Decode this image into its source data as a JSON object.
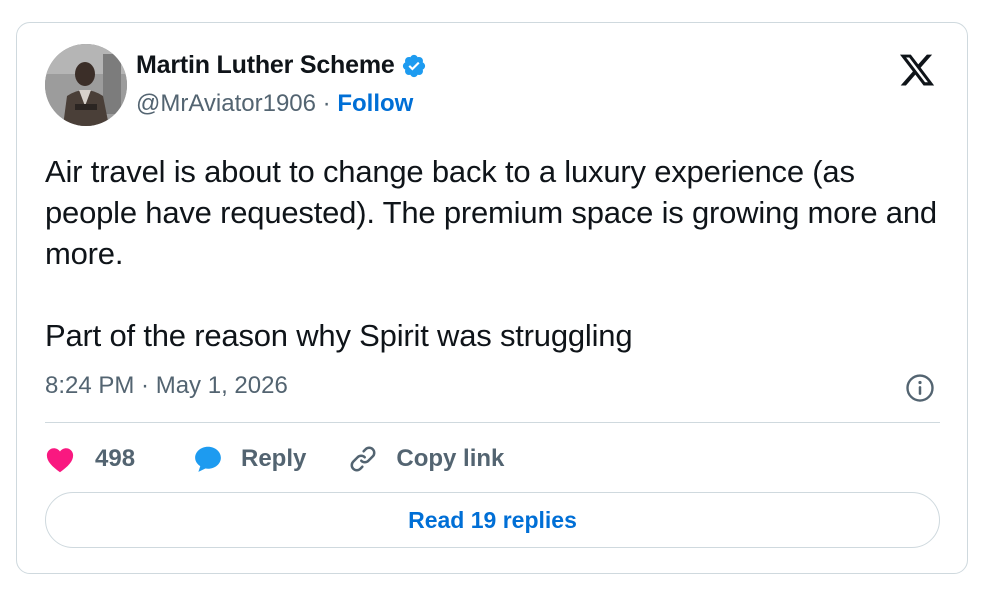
{
  "author": {
    "name": "Martin Luther Scheme",
    "handle": "@MrAviator1906",
    "separator": " · ",
    "follow_label": "Follow"
  },
  "tweet": {
    "paragraphs": [
      "Air travel is about to change back to a luxury experience (as people have requested). The premium space is growing more and more.",
      "Part of the reason why Spirit was struggling"
    ],
    "timestamp": "8:24 PM · May 1, 2026"
  },
  "actions": {
    "likes": "498",
    "reply_label": "Reply",
    "copy_link_label": "Copy link"
  },
  "read_replies_label": "Read 19 replies",
  "icons": {
    "verified": "verified-badge-icon",
    "platform": "x-logo-icon",
    "info": "info-icon",
    "like": "heart-icon",
    "reply": "speech-bubble-icon",
    "copy": "link-icon"
  },
  "colors": {
    "link_blue": "#006fd6",
    "verified_blue": "#1d9bf0",
    "heart_pink": "#f91880",
    "secondary_text": "#536471",
    "border": "#cfd9de"
  }
}
